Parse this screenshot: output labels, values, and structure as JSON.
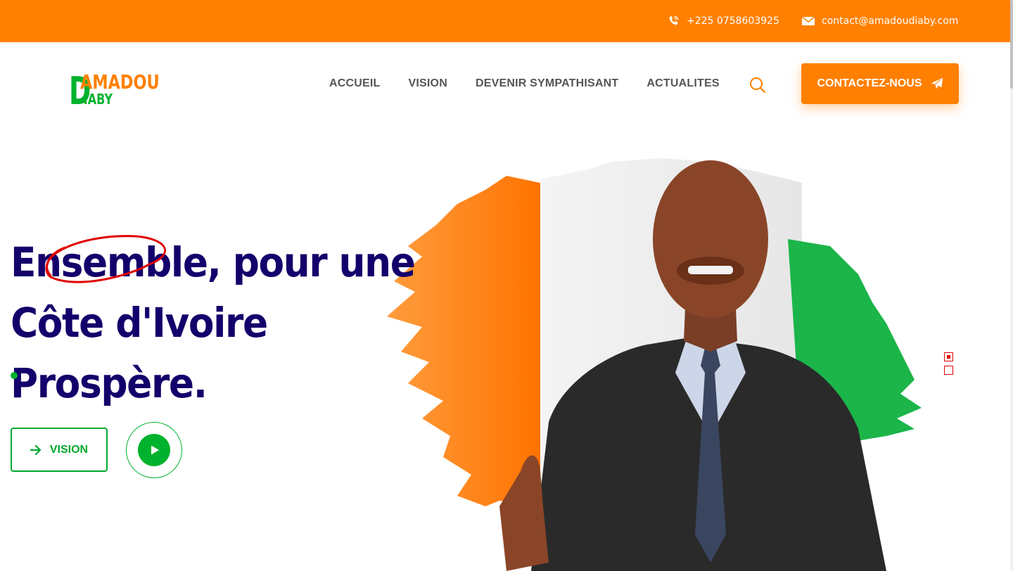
{
  "topbar": {
    "phone": "+225 0758603925",
    "email": "contact@amadoudiaby.com"
  },
  "logo": {
    "line1": "AMADOU",
    "line2": "IABY",
    "initial": "D"
  },
  "nav": {
    "items": [
      "ACCUEIL",
      "VISION",
      "DEVENIR SYMPATHISANT",
      "ACTUALITES"
    ]
  },
  "header": {
    "cta_label": "CONTACTEZ-NOUS"
  },
  "hero": {
    "headline_line1": "Ensemble, pour une",
    "headline_line2": "Côte d'Ivoire Prospère.",
    "vision_button": "VISION",
    "slides_total": 2,
    "slide_active": 1
  },
  "colors": {
    "brand_orange": "#ff8000",
    "brand_green": "#00b22d",
    "headline_navy": "#14006b",
    "accent_red": "#e00000"
  },
  "icons": {
    "phone": "phone-icon",
    "mail": "mail-icon",
    "search": "search-icon",
    "send": "paper-plane-icon",
    "arrow": "arrow-right-icon",
    "play": "play-icon"
  }
}
